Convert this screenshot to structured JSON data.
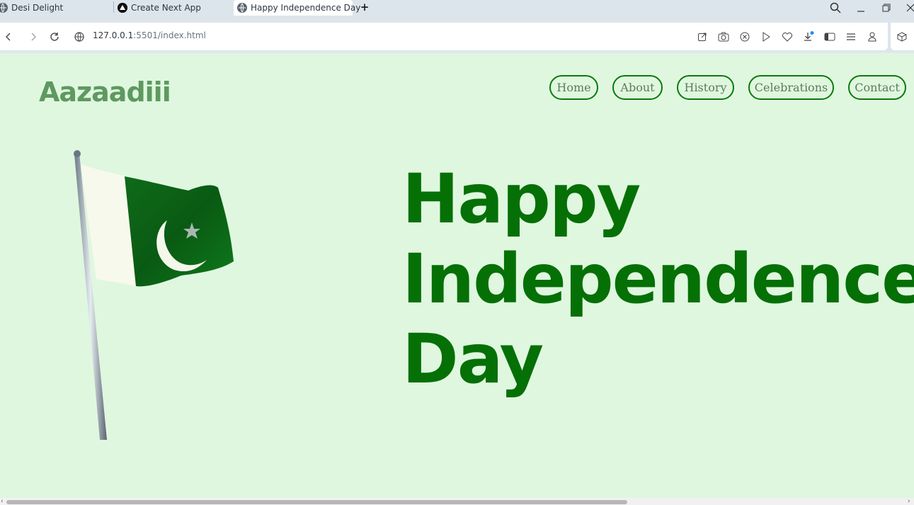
{
  "browser": {
    "tabs": [
      {
        "title": "Desi Delight",
        "icon": "globe-icon"
      },
      {
        "title": "Create Next App",
        "icon": "nextjs-icon"
      },
      {
        "title": "Happy Independence Day",
        "icon": "globe-icon",
        "active": true
      }
    ],
    "new_tab": "+",
    "url_host": "127.0.0.1",
    "url_rest": ":5501/index.html"
  },
  "page": {
    "logo": "Aazaadiii",
    "nav": [
      "Home",
      "About",
      "History",
      "Celebrations",
      "Contact"
    ],
    "hero_lines": [
      "Happy",
      "Independence",
      "Day"
    ]
  },
  "colors": {
    "page_bg": "#dff7df",
    "accent_green": "#057005",
    "logo_green": "#5e9960"
  }
}
